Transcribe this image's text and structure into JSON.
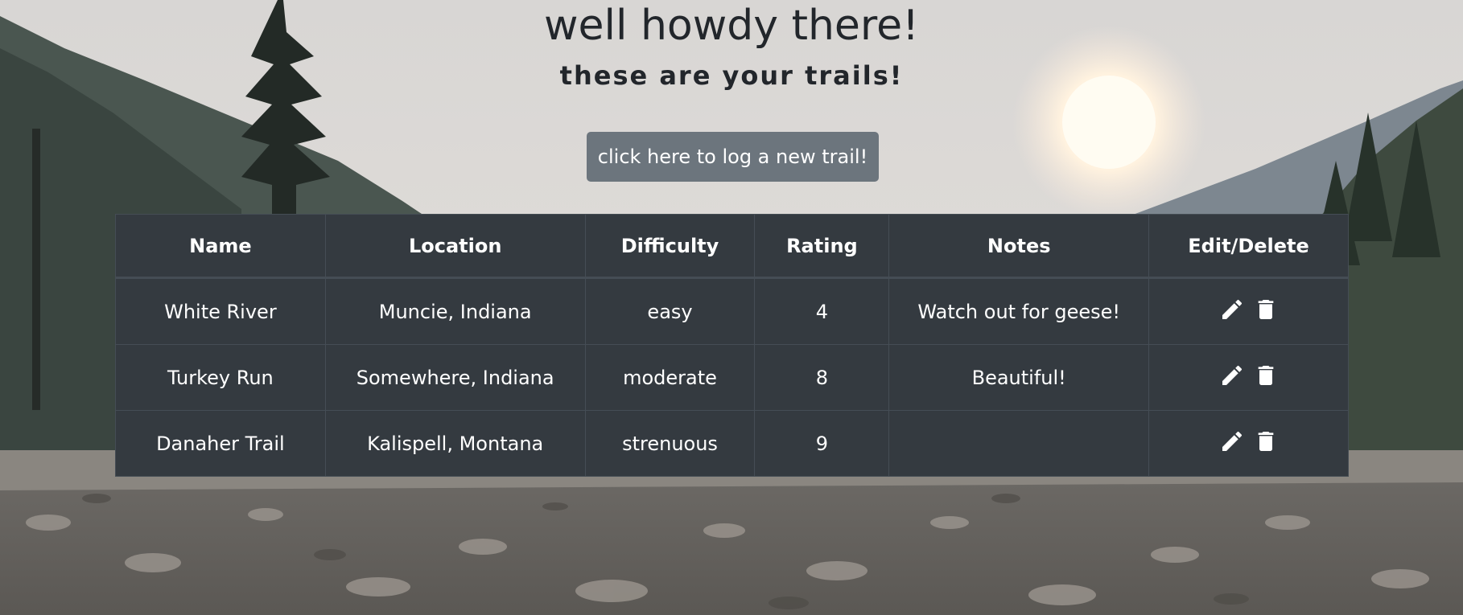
{
  "header": {
    "title": "well howdy there!",
    "subtitle": "these are your trails!"
  },
  "new_trail_button": "click here to log a new trail!",
  "table": {
    "columns": [
      "Name",
      "Location",
      "Difficulty",
      "Rating",
      "Notes",
      "Edit/Delete"
    ],
    "rows": [
      {
        "name": "White River",
        "location": "Muncie, Indiana",
        "difficulty": "easy",
        "rating": "4",
        "notes": "Watch out for geese!"
      },
      {
        "name": "Turkey Run",
        "location": "Somewhere, Indiana",
        "difficulty": "moderate",
        "rating": "8",
        "notes": "Beautiful!"
      },
      {
        "name": "Danaher Trail",
        "location": "Kalispell, Montana",
        "difficulty": "strenuous",
        "rating": "9",
        "notes": ""
      }
    ]
  },
  "icons": {
    "edit": "pencil-icon",
    "delete": "trash-icon"
  },
  "colors": {
    "table_bg": "#343a40",
    "table_border": "#454d55",
    "button_bg": "#6c757d",
    "heading_text": "#22262b"
  }
}
